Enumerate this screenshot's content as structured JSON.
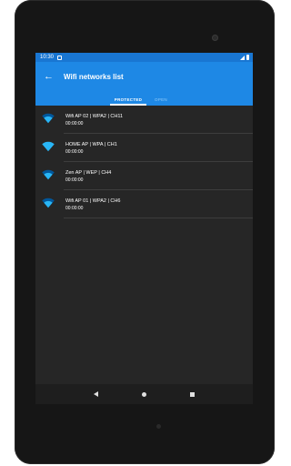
{
  "status_bar": {
    "time": "10:30"
  },
  "app_bar": {
    "back_icon": "arrow-left-icon",
    "title": "Wifi networks list"
  },
  "tabs": [
    {
      "label": "PROTECTED",
      "selected": true
    },
    {
      "label": "OPEN",
      "selected": false
    }
  ],
  "networks": [
    {
      "name": "Wifi AP 02 | WPA2 | CH11",
      "time": "00:00:00",
      "icon": "wifi-signal-icon"
    },
    {
      "name": "HOME AP | WPA | CH1",
      "time": "00:00:00",
      "icon": "wifi-signal-icon"
    },
    {
      "name": "Zen AP | WEP | CH4",
      "time": "00:00:00",
      "icon": "wifi-signal-icon"
    },
    {
      "name": "Wifi AP 01 | WPA2 | CH6",
      "time": "00:00:00",
      "icon": "wifi-signal-icon"
    }
  ],
  "nav_bar": {
    "back": "back-triangle-icon",
    "home": "home-circle-icon",
    "recent": "recents-square-icon"
  },
  "colors": {
    "accent": "#1e88e5",
    "status": "#1976d2",
    "wifi": "#29b6f6",
    "background": "#262626"
  }
}
